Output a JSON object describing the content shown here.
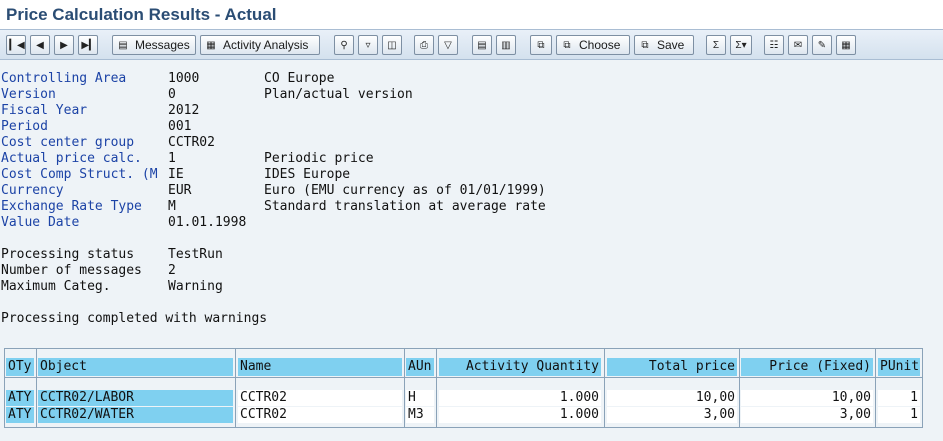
{
  "window": {
    "title": "Price Calculation Results - Actual"
  },
  "toolbar": {
    "messages_label": "Messages",
    "activity_analysis_label": "Activity Analysis",
    "choose_label": "Choose",
    "save_label": "Save"
  },
  "header_fields": [
    {
      "label": "Controlling Area",
      "value": "1000",
      "desc": "CO Europe"
    },
    {
      "label": "Version",
      "value": "0",
      "desc": "Plan/actual version"
    },
    {
      "label": "Fiscal Year",
      "value": "2012",
      "desc": ""
    },
    {
      "label": "Period",
      "value": "001",
      "desc": ""
    },
    {
      "label": "Cost center group",
      "value": "CCTR02",
      "desc": ""
    },
    {
      "label": "Actual price calc.",
      "value": "1",
      "desc": "Periodic price"
    },
    {
      "label": "Cost Comp Struct. (M",
      "value": "IE",
      "desc": "IDES Europe"
    },
    {
      "label": "Currency",
      "value": "EUR",
      "desc": "Euro (EMU currency as of 01/01/1999)"
    },
    {
      "label": "Exchange Rate Type",
      "value": "M",
      "desc": "Standard translation at average rate"
    },
    {
      "label": "Value Date",
      "value": "01.01.1998",
      "desc": ""
    }
  ],
  "status_fields": [
    {
      "label": "Processing status",
      "value": "TestRun"
    },
    {
      "label": "Number of messages",
      "value": "2"
    },
    {
      "label": "Maximum Categ.",
      "value": "Warning"
    }
  ],
  "completion_message": "Processing completed with warnings",
  "table": {
    "columns": {
      "oty": "OTy",
      "object": "Object",
      "name": "Name",
      "aun": "AUn",
      "activity_quantity": "Activity Quantity",
      "total_price": "Total price",
      "price_fixed": "Price (Fixed)",
      "punit": "PUnit"
    },
    "rows": [
      {
        "oty": "ATY",
        "object": "CCTR02/LABOR",
        "name": "CCTR02",
        "aun": "H",
        "activity_quantity": "1.000",
        "total_price": "10,00",
        "price_fixed": "10,00",
        "punit": "1"
      },
      {
        "oty": "ATY",
        "object": "CCTR02/WATER",
        "name": "CCTR02",
        "aun": "M3",
        "activity_quantity": "1.000",
        "total_price": "3,00",
        "price_fixed": "3,00",
        "punit": "1"
      }
    ]
  },
  "icons": [
    "first-page-icon",
    "previous-page-icon",
    "next-page-icon",
    "last-page-icon",
    "messages-icon",
    "activity-analysis-icon",
    "find-icon",
    "filter-icon",
    "layout-icon",
    "print-icon",
    "print-preview-icon",
    "export-icon",
    "local-file-icon",
    "choose-icon",
    "save-icon",
    "sum-icon",
    "subtotal-icon",
    "hierarchy-icon",
    "mail-icon",
    "edit-icon",
    "spreadsheet-icon"
  ]
}
